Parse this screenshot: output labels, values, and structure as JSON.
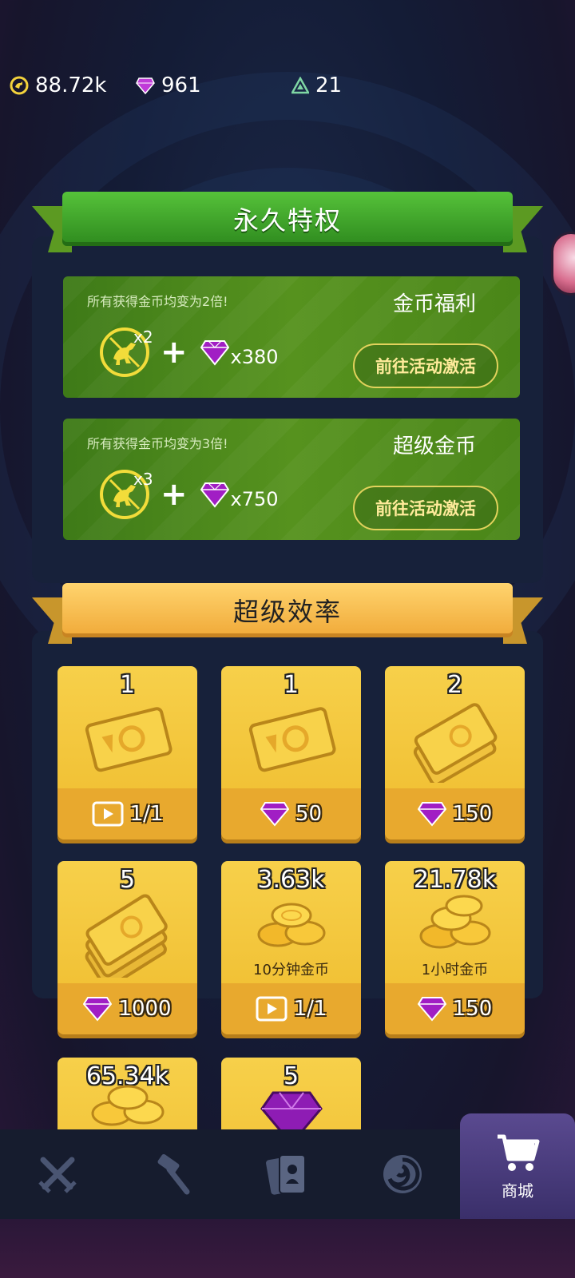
{
  "currency": {
    "coins": "88.72k",
    "gems": "961",
    "tokens": "21"
  },
  "sections": {
    "permanent_title": "永久特权",
    "efficiency_title": "超级效率"
  },
  "privileges": [
    {
      "desc": "所有获得金币均变为2倍!",
      "title": "金币福利",
      "dino_mult": "x2",
      "gem_qty": "x380",
      "button": "前往活动激活"
    },
    {
      "desc": "所有获得金币均变为3倍!",
      "title": "超级金币",
      "dino_mult": "x3",
      "gem_qty": "x750",
      "button": "前往活动激活"
    }
  ],
  "shop": [
    {
      "qty": "1",
      "art": "ticket-icon",
      "price": "1/1",
      "price_icon": "video-ad-icon"
    },
    {
      "qty": "1",
      "art": "ticket-icon",
      "price": "50",
      "price_icon": "gem-icon"
    },
    {
      "qty": "2",
      "art": "ticket-stack-icon",
      "price": "150",
      "price_icon": "gem-icon"
    },
    {
      "qty": "5",
      "art": "ticket-stack-icon",
      "price": "1000",
      "price_icon": "gem-icon"
    },
    {
      "qty": "3.63k",
      "art": "coin-pile-icon",
      "subtitle": "10分钟金币",
      "price": "1/1",
      "price_icon": "video-ad-icon"
    },
    {
      "qty": "21.78k",
      "art": "coin-pile-icon",
      "subtitle": "1小时金币",
      "price": "150",
      "price_icon": "gem-icon"
    },
    {
      "qty": "65.34k",
      "art": "coin-pile-icon"
    },
    {
      "qty": "5",
      "art": "gem-pile-icon"
    }
  ],
  "nav": {
    "items": [
      "battle-swords-icon",
      "hammer-icon",
      "cards-icon",
      "portal-icon",
      "cart-icon"
    ],
    "shop_label": "商城"
  },
  "colors": {
    "gem": "#9b1fbf",
    "gold": "#f2c53d",
    "green": "#4a8a1c"
  }
}
